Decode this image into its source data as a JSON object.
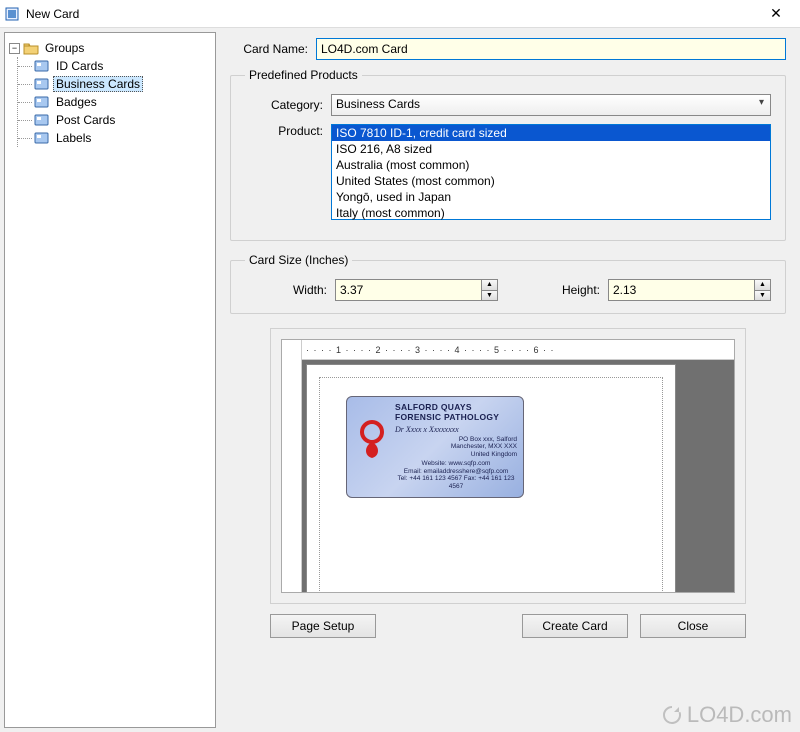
{
  "window": {
    "title": "New Card"
  },
  "sidebar": {
    "root": "Groups",
    "items": [
      {
        "label": "ID Cards"
      },
      {
        "label": "Business Cards",
        "selected": true
      },
      {
        "label": "Badges"
      },
      {
        "label": "Post Cards"
      },
      {
        "label": "Labels"
      }
    ]
  },
  "form": {
    "card_name_label": "Card Name:",
    "card_name_value": "LO4D.com Card",
    "predefined_legend": "Predefined Products",
    "category_label": "Category:",
    "category_value": "Business Cards",
    "product_label": "Product:",
    "products": [
      {
        "label": "ISO 7810 ID-1, credit card sized",
        "selected": true
      },
      {
        "label": "ISO 216, A8 sized"
      },
      {
        "label": "Australia (most common)"
      },
      {
        "label": "United States (most common)"
      },
      {
        "label": "Yongō, used in Japan"
      },
      {
        "label": "Italy (most common)"
      }
    ],
    "size_legend": "Card Size (Inches)",
    "width_label": "Width:",
    "width_value": "3.37",
    "height_label": "Height:",
    "height_value": "2.13"
  },
  "ruler": {
    "h_ticks": "· · · · 1 · · · · 2 · · · · 3 · · · · 4 · · · · 5 · · · · 6 · ·"
  },
  "sample_card": {
    "title1": "SALFORD QUAYS",
    "title2": "FORENSIC PATHOLOGY",
    "name": "Dr Xxxx x Xxxxxxxx",
    "addr1": "PO Box xxx, Salford",
    "addr2": "Manchester, MXX XXX",
    "addr3": "United Kingdom",
    "web": "Website:  www.sqfp.com",
    "email": "Email:  emailaddresshere@sqfp.com",
    "tel": "Tel: +44 161 123 4567   Fax: +44 161 123 4567"
  },
  "buttons": {
    "page_setup": "Page Setup",
    "create_card": "Create Card",
    "close": "Close"
  },
  "watermark": "LO4D.com"
}
